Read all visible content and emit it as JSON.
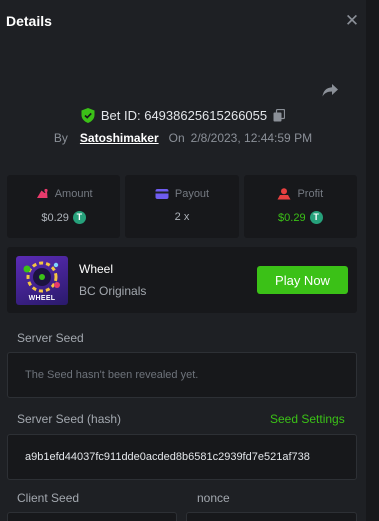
{
  "header": {
    "title": "Details"
  },
  "bet": {
    "id_label": "Bet ID: 64938625615266055",
    "by_label": "By",
    "username": "Satoshimaker",
    "on_label": "On",
    "datetime": "2/8/2023, 12:44:59 PM"
  },
  "stats": {
    "amount": {
      "label": "Amount",
      "value": "$0.29"
    },
    "payout": {
      "label": "Payout",
      "value": "2 x"
    },
    "profit": {
      "label": "Profit",
      "value": "$0.29"
    }
  },
  "game": {
    "thumb_label": "WHEEL",
    "name": "Wheel",
    "provider": "BC Originals",
    "play_label": "Play Now"
  },
  "server_seed": {
    "label": "Server Seed",
    "value": "The Seed hasn't been revealed yet."
  },
  "server_seed_hash": {
    "label": "Server Seed (hash)",
    "settings_label": "Seed Settings",
    "value": "a9b1efd44037fc911dde0acded8b6581c2939fd7e521af738"
  },
  "client_seed": {
    "label": "Client Seed"
  },
  "nonce": {
    "label": "nonce"
  },
  "colors": {
    "background": "#1e2024",
    "card": "#17181b",
    "accent_green": "#3bc117",
    "amount_pink": "#e83a6b",
    "payout_purple": "#6f5cf0",
    "profit_red": "#e84040",
    "tether": "#26a17b"
  },
  "icons": {
    "close": "close-icon",
    "share": "share-icon",
    "shield": "shield-check-icon",
    "copy": "copy-icon",
    "amount": "bet-amount-icon",
    "payout": "payout-wallet-icon",
    "profit": "profit-icon",
    "currency": "tether-icon"
  }
}
